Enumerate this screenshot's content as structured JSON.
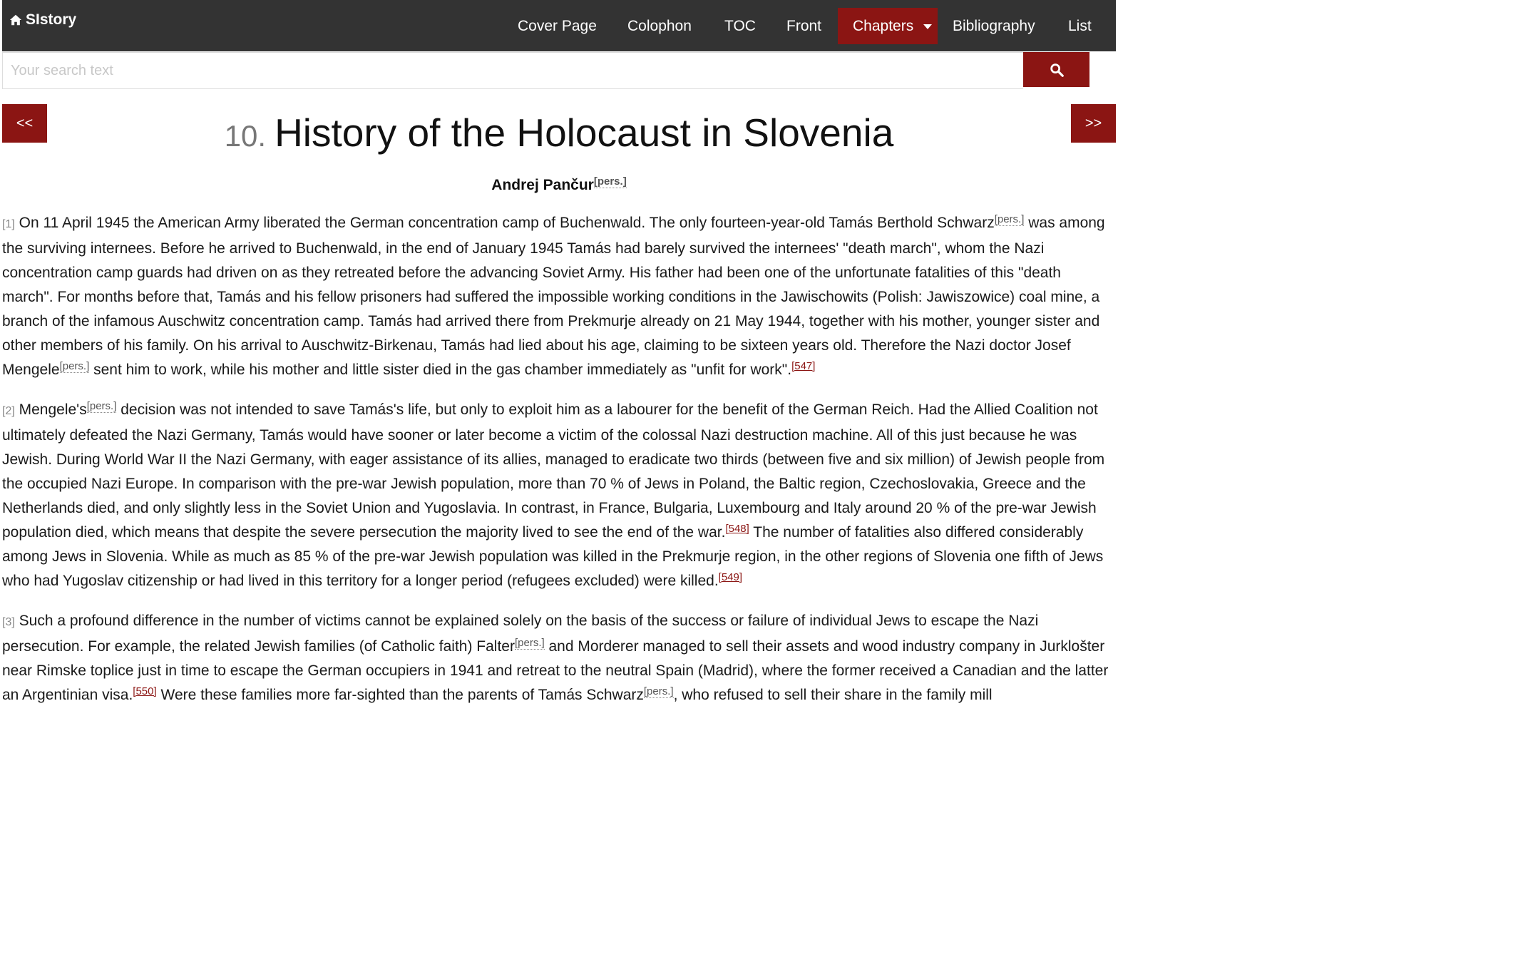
{
  "brand": {
    "name": "SIstory",
    "icon": "home-icon"
  },
  "nav": {
    "items": [
      {
        "label": "Cover Page"
      },
      {
        "label": "Colophon"
      },
      {
        "label": "TOC"
      },
      {
        "label": "Front"
      },
      {
        "label": "Chapters"
      },
      {
        "label": "Bibliography"
      },
      {
        "label": "List"
      }
    ],
    "active": "Chapters",
    "accent_color": "#8b1513",
    "bar_color": "#333333"
  },
  "search": {
    "placeholder": "Your search text",
    "value": "",
    "icon": "search-icon"
  },
  "pager": {
    "prev_label": "<<",
    "next_label": ">>"
  },
  "chapter": {
    "number": "10.",
    "title": "History of the Holocaust in Slovenia",
    "author": "Andrej Pančur",
    "pers_label": "[pers.]"
  },
  "paragraphs": [
    {
      "num": "[1]",
      "segments": [
        {
          "t": "text",
          "v": " On 11 April 1945 the American Army liberated the German concentration camp of Buchenwald. The only fourteen-year-old Tamás Berthold Schwarz"
        },
        {
          "t": "pers",
          "v": "[pers.]"
        },
        {
          "t": "text",
          "v": " was among the surviving internees. Before he arrived to Buchenwald, in the end of January 1945 Tamás had barely survived the internees' \"death march\", whom the Nazi concentration camp guards had driven on as they retreated before the advancing Soviet Army. His father had been one of the unfortunate fatalities of this \"death march\". For months before that, Tamás and his fellow prisoners had suffered the impossible working conditions in the Jawischowits (Polish: Jawiszowice) coal mine, a branch of the infamous Auschwitz concentration camp. Tamás had arrived there from Prekmurje already on 21 May 1944, together with his mother, younger sister and other members of his family. On his arrival to Auschwitz-Birkenau, Tamás had lied about his age, claiming to be sixteen years old. Therefore the Nazi doctor Josef Mengele"
        },
        {
          "t": "pers",
          "v": "[pers.]"
        },
        {
          "t": "text",
          "v": " sent him to work, while his mother and little sister died in the gas chamber immediately as \"unfit for work\"."
        },
        {
          "t": "fn",
          "v": "[547]"
        }
      ]
    },
    {
      "num": "[2]",
      "segments": [
        {
          "t": "text",
          "v": " Mengele's"
        },
        {
          "t": "pers",
          "v": "[pers.]"
        },
        {
          "t": "text",
          "v": " decision was not intended to save Tamás's life, but only to exploit him as a labourer for the benefit of the German Reich. Had the Allied Coalition not ultimately defeated the Nazi Germany, Tamás would have sooner or later become a victim of the colossal Nazi destruction machine. All of this just because he was Jewish. During World War II the Nazi Germany, with eager assistance of its allies, managed to eradicate two thirds (between five and six million) of Jewish people from the occupied Nazi Europe. In comparison with the pre-war Jewish population, more than 70 % of Jews in Poland, the Baltic region, Czechoslovakia, Greece and the Netherlands died, and only slightly less in the Soviet Union and Yugoslavia. In contrast, in France, Bulgaria, Luxembourg and Italy around 20 % of the pre-war Jewish population died, which means that despite the severe persecution the majority lived to see the end of the war."
        },
        {
          "t": "fn",
          "v": "[548]"
        },
        {
          "t": "text",
          "v": " The number of fatalities also differed considerably among Jews in Slovenia. While as much as 85 % of the pre-war Jewish population was killed in the Prekmurje region, in the other regions of Slovenia one fifth of Jews who had Yugoslav citizenship or had lived in this territory for a longer period (refugees excluded) were killed."
        },
        {
          "t": "fn",
          "v": "[549]"
        }
      ]
    },
    {
      "num": "[3]",
      "segments": [
        {
          "t": "text",
          "v": " Such a profound difference in the number of victims cannot be explained solely on the basis of the success or failure of individual Jews to escape the Nazi persecution. For example, the related Jewish families (of Catholic faith) Falter"
        },
        {
          "t": "pers",
          "v": "[pers.]"
        },
        {
          "t": "text",
          "v": " and Morderer managed to sell their assets and wood industry company in Jurklošter near Rimske toplice just in time to escape the German occupiers in 1941 and retreat to the neutral Spain (Madrid), where the former received a Canadian and the latter an Argentinian visa."
        },
        {
          "t": "fn",
          "v": "[550]"
        },
        {
          "t": "text",
          "v": " Were these families more far-sighted than the parents of Tamás Schwarz"
        },
        {
          "t": "pers",
          "v": "[pers.]"
        },
        {
          "t": "text",
          "v": ", who refused to sell their share in the family mill"
        }
      ]
    }
  ]
}
